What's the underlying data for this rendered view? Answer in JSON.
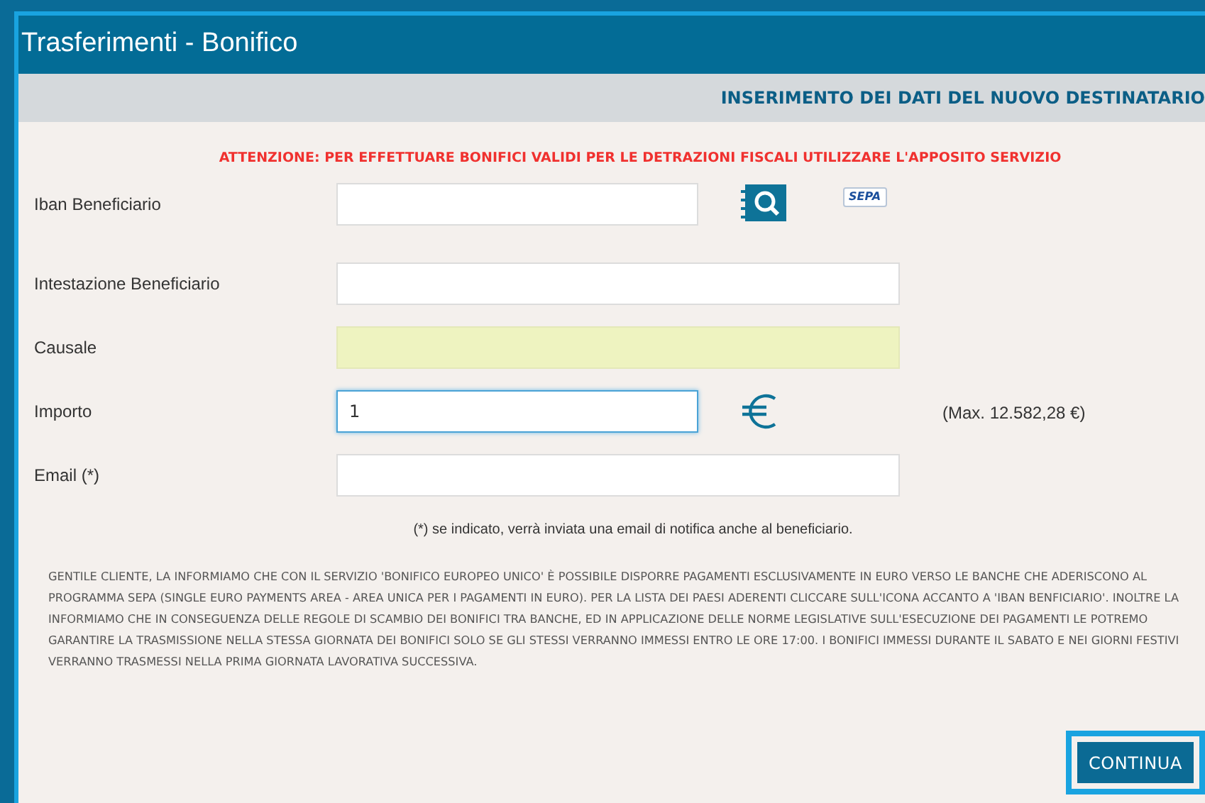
{
  "window": {
    "title": "Trasferimenti - Bonifico"
  },
  "section_header": "INSERIMENTO DEI DATI DEL NUOVO DESTINATARIO",
  "warning": "ATTENZIONE: PER EFFETTUARE BONIFICI VALIDI PER LE DETRAZIONI FISCALI UTILIZZARE L'APPOSITO SERVIZIO",
  "fields": [
    {
      "kind": "iban",
      "label": "Iban Beneficiario",
      "highlighted": false,
      "focused": false,
      "sepa_logo": "SEPA"
    },
    {
      "kind": "text",
      "label": "Intestazione Beneficiario",
      "highlighted": false,
      "focused": false
    },
    {
      "kind": "text",
      "label": "Causale",
      "highlighted": true,
      "focused": false
    },
    {
      "kind": "amount",
      "label": "Importo",
      "value": "1",
      "highlighted": false,
      "focused": true,
      "note": "(Max. 12.582,28 €)"
    },
    {
      "kind": "text",
      "label": "Email (*)",
      "highlighted": false,
      "focused": false
    }
  ],
  "footnote": "(*) se indicato, verrà inviata una email di notifica anche al beneficiario.",
  "info": "GENTILE CLIENTE, LA INFORMIAMO CHE CON IL SERVIZIO 'BONIFICO EUROPEO UNICO' È POSSIBILE DISPORRE PAGAMENTI ESCLUSIVAMENTE IN EURO VERSO LE BANCHE CHE ADERISCONO AL PROGRAMMA SEPA (SINGLE EURO PAYMENTS AREA - AREA UNICA PER I PAGAMENTI IN EURO). PER LA LISTA DEI PAESI ADERENTI CLICCARE SULL'ICONA ACCANTO A 'IBAN BENFICIARIO'. INOLTRE LA INFORMIAMO CHE IN CONSEGUENZA DELLE REGOLE DI SCAMBIO DEI BONIFICI TRA BANCHE, ED IN APPLICAZIONE DELLE NORME LEGISLATIVE SULL'ESECUZIONE DEI PAGAMENTI LE POTREMO GARANTIRE LA TRASMISSIONE NELLA STESSA GIORNATA DEI BONIFICI SOLO SE GLI STESSI VERRANNO IMMESSI ENTRO LE ORE 17:00. I BONIFICI IMMESSI DURANTE IL SABATO E NEI GIORNI FESTIVI VERRANNO TRASMESSI NELLA PRIMA GIORNATA LAVORATIVA SUCCESSIVA.",
  "continue_button": {
    "label": "CONTINUA",
    "focused": true
  }
}
